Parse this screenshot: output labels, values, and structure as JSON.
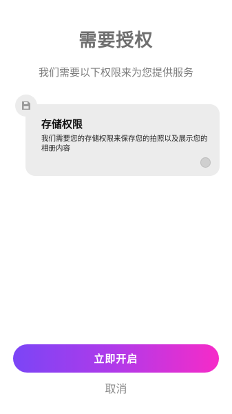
{
  "header": {
    "title": "需要授权",
    "subtitle": "我们需要以下权限来为您提供服务"
  },
  "permission_card": {
    "icon": "save-icon",
    "title": "存储权限",
    "description": "我们需要您的存储权限来保存您的拍照以及展示您的相册内容"
  },
  "actions": {
    "enable_label": "立即开启",
    "cancel_label": "取消"
  },
  "colors": {
    "gradient_start": "#7b45f6",
    "gradient_end": "#f62bc8",
    "card_bg": "#ececec"
  }
}
